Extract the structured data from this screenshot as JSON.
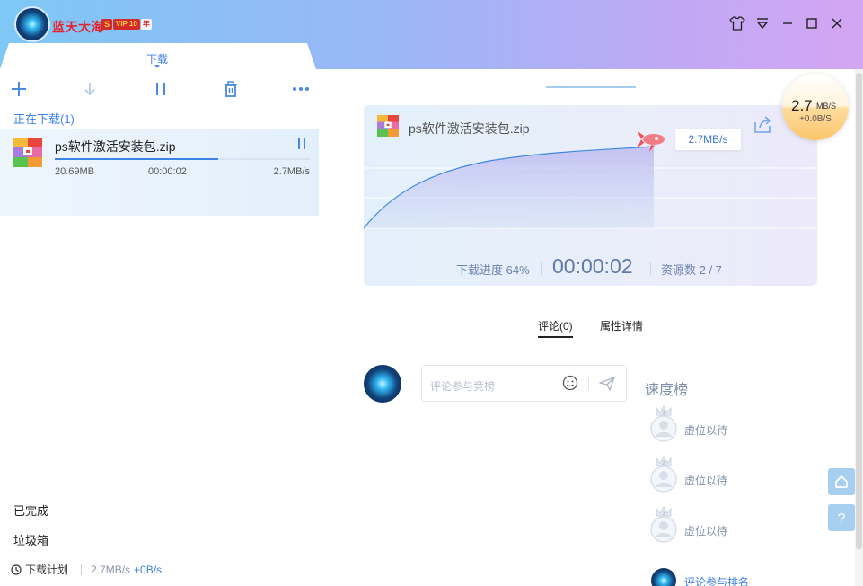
{
  "header": {
    "username": "蓝天大海",
    "vip_s": "S",
    "vip_label": "VIP 10",
    "vip_year": "年",
    "window_controls": [
      "skin-icon",
      "menu-icon",
      "minimize-icon",
      "maximize-icon",
      "close-icon"
    ]
  },
  "left": {
    "tab_label": "下载",
    "toolbar": [
      "add-icon",
      "download-icon",
      "pause-all-icon",
      "delete-icon",
      "more-icon"
    ],
    "section_downloading": "正在下载(1)",
    "item": {
      "name": "ps软件激活安装包.zip",
      "size": "20.69MB",
      "time": "00:00:02",
      "speed": "2.7MB/s",
      "progress": 0.64
    },
    "completed": "已完成",
    "trash": "垃圾箱",
    "footer": {
      "schedule": "下载计划",
      "down_speed": "2.7MB/s",
      "up_speed": "+0B/s"
    }
  },
  "right": {
    "speed_bubble": {
      "value": "2.7",
      "unit": "MB/S",
      "sub": "+0.0B/S"
    },
    "chart": {
      "file_name": "ps软件激活安装包.zip",
      "speed_tag": "2.7MB/s",
      "progress_label": "下载进度 64%",
      "time": "00:00:02",
      "sources": "资源数 2 / 7"
    },
    "tabs": {
      "comments": "评论(0)",
      "details": "属性详情"
    },
    "comment": {
      "placeholder": "评论参与竞榜"
    },
    "ranking": {
      "title": "速度榜",
      "items": [
        "虚位以待",
        "虚位以待",
        "虚位以待"
      ],
      "join": "评论参与排名"
    }
  },
  "colors": {
    "accent": "#3d84e8",
    "header_start": "#7ec8f5",
    "header_end": "#d4a6f3",
    "username": "#e8212e"
  }
}
